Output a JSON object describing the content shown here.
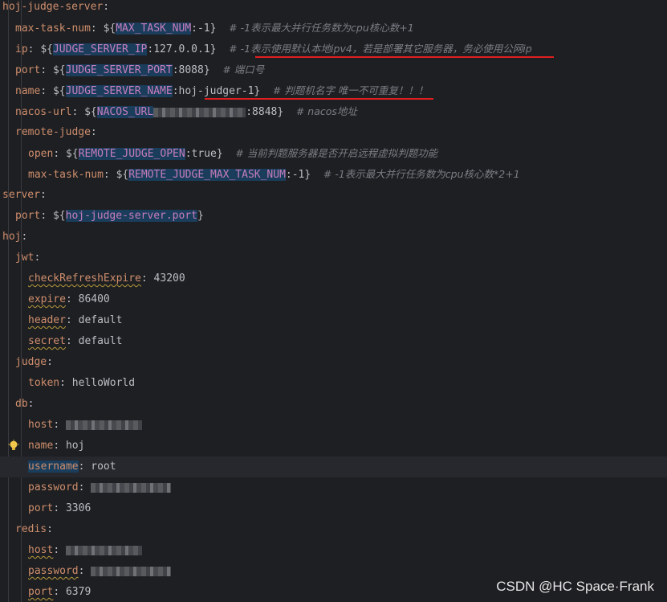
{
  "lines": [
    {
      "indent": 0,
      "key": "hoj-judge-server"
    },
    {
      "indent": 1,
      "key": "max-task-num",
      "pre": "${",
      "var": "MAX_TASK_NUM",
      "def": ":-1}",
      "comment": "# -1表示最大并行任务数为cpu核心数+1"
    },
    {
      "indent": 1,
      "key": "ip",
      "pre": "${",
      "var": "JUDGE_SERVER_IP",
      "def": ":127.0.0.1}",
      "comment": "# -1表示使用默认本地ipv4，若是部署其它服务器，务必使用公网ip"
    },
    {
      "indent": 1,
      "key": "port",
      "pre": "${",
      "var": "JUDGE_SERVER_PORT",
      "def": ":8088}",
      "comment": "# 端口号"
    },
    {
      "indent": 1,
      "key": "name",
      "pre": "${",
      "var": "JUDGE_SERVER_NAME",
      "def": ":hoj-judger-1}",
      "comment": "# 判题机名字 唯一不可重复！！！"
    },
    {
      "indent": 1,
      "key": "nacos-url",
      "pre": "${",
      "var": "NACOS_URL",
      "def": ":8848}",
      "comment": "# nacos地址",
      "redacted": true
    },
    {
      "indent": 1,
      "key": "remote-judge"
    },
    {
      "indent": 2,
      "key": "open",
      "pre": "${",
      "var": "REMOTE_JUDGE_OPEN",
      "def": ":true}",
      "comment": "# 当前判题服务器是否开启远程虚拟判题功能"
    },
    {
      "indent": 2,
      "key": "max-task-num",
      "pre": "${",
      "var": "REMOTE_JUDGE_MAX_TASK_NUM",
      "def": ":-1}",
      "comment": "# -1表示最大并行任务数为cpu核心数*2+1"
    },
    {
      "indent": 0,
      "key": "server"
    },
    {
      "indent": 1,
      "key": "port",
      "pre": "${",
      "var": "hoj-judge-server.port",
      "def": "}"
    },
    {
      "indent": 0,
      "key": "hoj"
    },
    {
      "indent": 1,
      "key": "jwt"
    },
    {
      "indent": 2,
      "key": "checkRefreshExpire",
      "value": "43200",
      "squiggle": true
    },
    {
      "indent": 2,
      "key": "expire",
      "value": "86400",
      "squiggle": true
    },
    {
      "indent": 2,
      "key": "header",
      "value": "default",
      "squiggle": true
    },
    {
      "indent": 2,
      "key": "secret",
      "value": "default",
      "squiggle": true
    },
    {
      "indent": 1,
      "key": "judge"
    },
    {
      "indent": 2,
      "key": "token",
      "value": "helloWorld"
    },
    {
      "indent": 1,
      "key": "db"
    },
    {
      "indent": 2,
      "key": "host",
      "redacted": true
    },
    {
      "indent": 2,
      "key": "name",
      "value": "hoj",
      "bulb": true
    },
    {
      "indent": 2,
      "key": "username",
      "value": "root",
      "current": true,
      "keyHighlight": true
    },
    {
      "indent": 2,
      "key": "password",
      "redacted": true
    },
    {
      "indent": 2,
      "key": "port",
      "value": "3306"
    },
    {
      "indent": 1,
      "key": "redis"
    },
    {
      "indent": 2,
      "key": "host",
      "redacted": true,
      "squiggle": true
    },
    {
      "indent": 2,
      "key": "password",
      "redacted": true,
      "squiggle": true
    },
    {
      "indent": 2,
      "key": "port",
      "value": "6379",
      "squiggle": true
    }
  ],
  "watermark": "CSDN @HC Space·Frank",
  "colors": {
    "background": "#1e1f22",
    "key": "#cf8e6d",
    "envVar": "#c77dbb",
    "envVarBg": "#1a3d5c",
    "comment": "#7a7e85",
    "annotation": "#e01e1e"
  }
}
